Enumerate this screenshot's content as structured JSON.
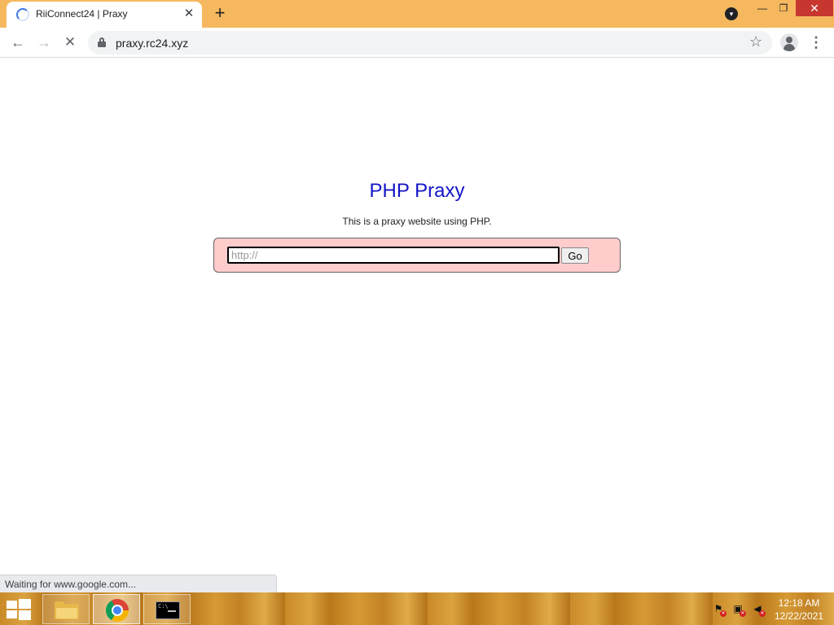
{
  "browser": {
    "tab": {
      "title": "RiiConnect24 | Praxy",
      "close_glyph": "✕"
    },
    "new_tab_glyph": "+",
    "toolbar": {
      "back_glyph": "←",
      "forward_glyph": "→",
      "stop_glyph": "✕",
      "url": "praxy.rc24.xyz",
      "bookmark_glyph": "☆",
      "menu_glyph": "⋮"
    },
    "window_controls": {
      "minimize": "—",
      "maximize": "❐",
      "close": "✕"
    },
    "status_text": "Waiting for www.google.com..."
  },
  "page": {
    "title": "PHP Praxy",
    "tagline": "This is a praxy website using PHP.",
    "form": {
      "url_placeholder": "http://",
      "go_label": "Go"
    }
  },
  "taskbar": {
    "apps": [
      {
        "name": "File Explorer",
        "icon": "folder-icon"
      },
      {
        "name": "Google Chrome",
        "icon": "chrome-icon",
        "active": true
      },
      {
        "name": "Command Prompt",
        "icon": "cmd-icon"
      }
    ],
    "clock": {
      "time": "12:18 AM",
      "date": "12/22/2021"
    }
  },
  "colors": {
    "tab_strip": "#f5b85e",
    "page_title": "#1515c8",
    "form_background": "#ffcccc",
    "close_button": "#c7372f"
  }
}
